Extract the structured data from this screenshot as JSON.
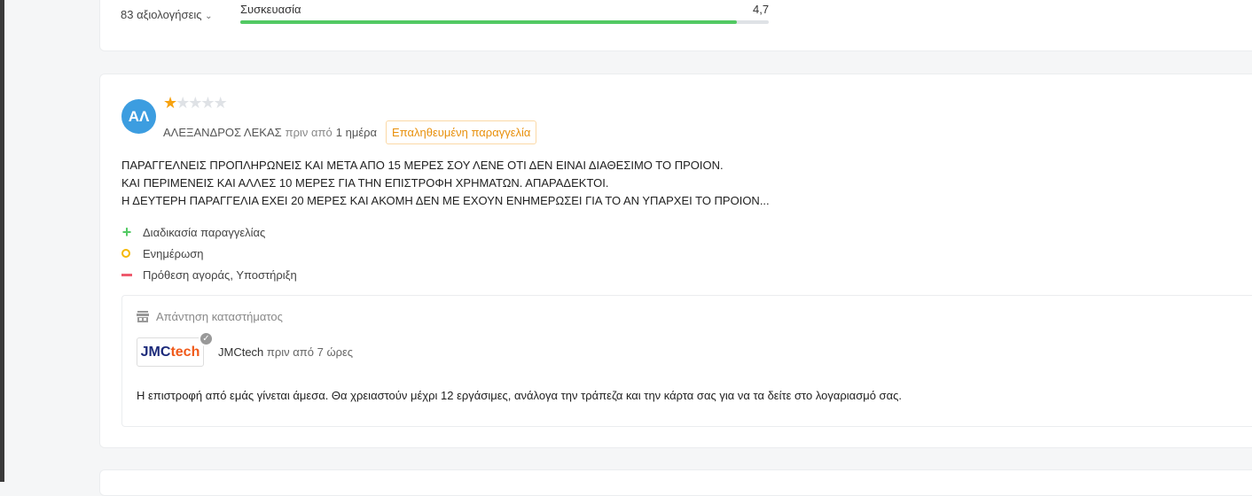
{
  "summary": {
    "reviews_count": "83 αξιολογήσεις",
    "criterion": "Συσκευασία",
    "score": "4,7",
    "fill_percent": 94
  },
  "review": {
    "initials": "ΑΛ",
    "rating": 1,
    "max_rating": 5,
    "author": "ΑΛΕΞΑΝΔΡΟΣ ΛΕΚΑΣ",
    "time_prefix": "πριν από",
    "time": "1 ημέρα",
    "badge": "Επαληθευμένη παραγγελία",
    "text": [
      "ΠΑΡΑΓΓΕΛΝΕΙΣ ΠΡΟΠΛΗΡΩΝΕΙΣ ΚΑΙ ΜΕΤΑ ΑΠΟ 15 ΜΕΡΕΣ ΣΟΥ ΛΕΝΕ ΟΤΙ ΔΕΝ ΕΙΝΑΙ ΔΙΑΘΕΣΙΜΟ ΤΟ ΠΡΟΙΟΝ.",
      "ΚΑΙ ΠΕΡΙΜΕΝΕΙΣ ΚΑΙ ΑΛΛΕΣ 10 ΜΕΡΕΣ ΓΙΑ ΤΗΝ ΕΠΙΣΤΡΟΦΗ ΧΡΗΜΑΤΩΝ. ΑΠΑΡΑΔΕΚΤΟΙ.",
      "Η ΔΕΥΤΕΡΗ ΠΑΡΑΓΓΕΛΙΑ ΕΧΕΙ 20 ΜΕΡΕΣ ΚΑΙ ΑΚΟΜΗ ΔΕΝ ΜΕ ΕΧΟΥΝ ΕΝΗΜΕΡΩΣΕΙ ΓΙΑ ΤΟ ΑΝ ΥΠΑΡΧΕΙ ΤΟ ΠΡΟΙΟΝ..."
    ],
    "positive": "Διαδικασία παραγγελίας",
    "neutral": "Ενημέρωση",
    "negative": "Πρόθεση αγοράς, Υποστήριξη"
  },
  "reply": {
    "header": "Απάντηση καταστήματος",
    "logo_a": "JMC",
    "logo_b": "tech",
    "shop": "JMCtech",
    "time": "πριν από 7 ώρες",
    "text": "Η επιστροφή από εμάς γίνεται άμεσα. Θα χρειαστούν μέχρι 12 εργάσιμες, ανάλογα την τράπεζα και την κάρτα σας για να τα δείτε στο λογαριασμό σας."
  }
}
